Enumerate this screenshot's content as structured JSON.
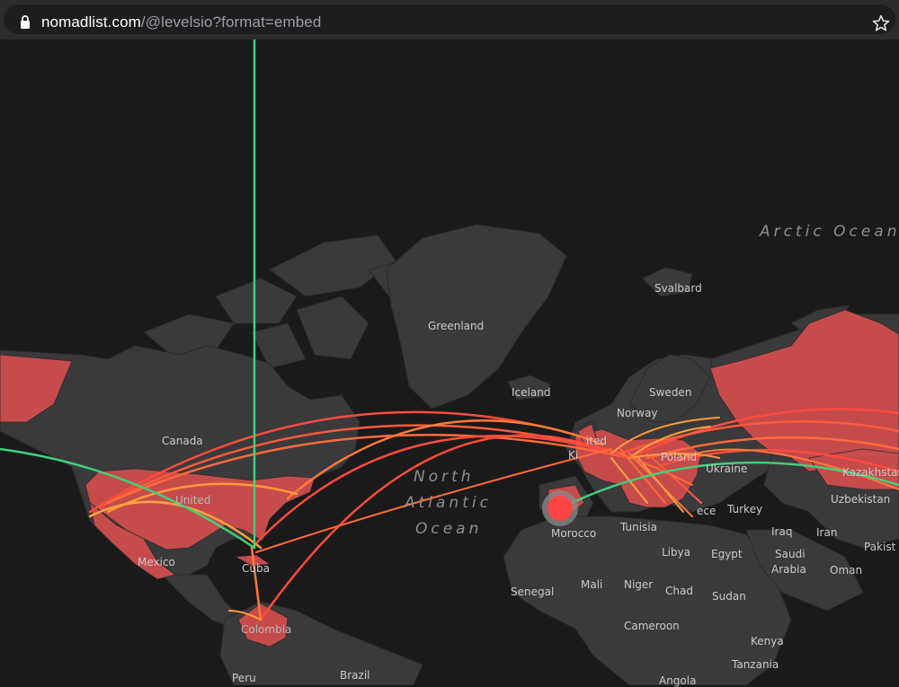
{
  "browser": {
    "url_host": "nomadlist.com",
    "url_path": "/@levelsio?format=embed",
    "icons": [
      "lock-icon",
      "star-icon"
    ]
  },
  "map": {
    "oceans": {
      "arctic": "Arctic Ocean",
      "north_atlantic": [
        "North",
        "Atlantic",
        "Ocean"
      ]
    },
    "labels": {
      "greenland": "Greenland",
      "svalbard": "Svalbard",
      "iceland": "Iceland",
      "sweden": "Sweden",
      "norway": "Norway",
      "canada": "Canada",
      "united": "United",
      "kingdom_partial": "ited",
      "ki_partial": "Ki",
      "poland": "Poland",
      "ukraine": "Ukraine",
      "kazakhstan_partial": "Kazakhstan",
      "uzbekistan": "Uzbekistan",
      "turkey": "Turkey",
      "greece_partial": "ece",
      "tunisia": "Tunisia",
      "morocco": "Morocco",
      "mexico": "Mexico",
      "cuba": "Cuba",
      "libya": "Libya",
      "egypt": "Egypt",
      "iraq": "Iraq",
      "iran": "Iran",
      "saudi_arabia": [
        "Saudi",
        "Arabia"
      ],
      "oman": "Oman",
      "pakistan_partial": "Pakist",
      "senegal": "Senegal",
      "mali": "Mali",
      "niger": "Niger",
      "chad": "Chad",
      "sudan": "Sudan",
      "cameroon": "Cameroon",
      "kenya": "Kenya",
      "tanzania": "Tanzania",
      "colombia": "Colombia",
      "peru": "Peru",
      "brazil": "Brazil",
      "angola_partial": "Angola"
    },
    "colors": {
      "land": "#3a3a3c",
      "visited": "#c64b4b",
      "route_red": "#ff4b3e",
      "route_orange": "#ff9a3a",
      "route_green": "#3fd07a",
      "current_marker": "#ff4444"
    }
  }
}
